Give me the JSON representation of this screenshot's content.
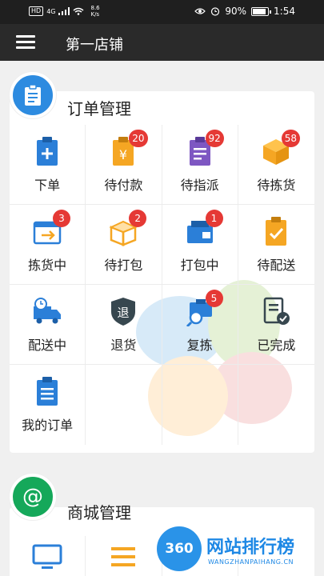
{
  "status_bar": {
    "hd": "HD",
    "signal": "4G",
    "net_speed": "8.6\nK/s",
    "battery": "90%",
    "time": "1:54",
    "battery_level": 0.9
  },
  "header": {
    "title": "第一店铺"
  },
  "order_section": {
    "title": "订单管理",
    "items": [
      {
        "label": "下单",
        "count": "",
        "icon": "clipboard-plus-icon"
      },
      {
        "label": "待付款",
        "count": "20",
        "icon": "yen-bag-icon"
      },
      {
        "label": "待指派",
        "count": "92",
        "icon": "clipboard-list-icon"
      },
      {
        "label": "待拣货",
        "count": "58",
        "icon": "box-icon"
      },
      {
        "label": "拣货中",
        "count": "3",
        "icon": "picking-icon"
      },
      {
        "label": "待打包",
        "count": "2",
        "icon": "open-box-icon"
      },
      {
        "label": "打包中",
        "count": "1",
        "icon": "packing-icon"
      },
      {
        "label": "待配送",
        "count": "",
        "icon": "clipboard-check-icon"
      },
      {
        "label": "配送中",
        "count": "",
        "icon": "delivery-truck-icon"
      },
      {
        "label": "退货",
        "count": "",
        "icon": "return-shield-icon"
      },
      {
        "label": "复拣",
        "count": "5",
        "icon": "recheck-icon"
      },
      {
        "label": "已完成",
        "count": "",
        "icon": "completed-icon"
      },
      {
        "label": "我的订单",
        "count": "",
        "icon": "my-orders-icon"
      }
    ]
  },
  "mall_section": {
    "title": "商城管理"
  },
  "site_watermark": {
    "logo": "360",
    "name": "网站排行榜",
    "domain": "WANGZHANPAIHANG.CN"
  },
  "colors": {
    "order_accent": "#2d8be0",
    "mall_accent": "#15a85a",
    "badge_red": "#e53935",
    "icon_blue": "#2b7fd8",
    "icon_orange": "#f5a623",
    "icon_purple": "#7e57c2"
  }
}
